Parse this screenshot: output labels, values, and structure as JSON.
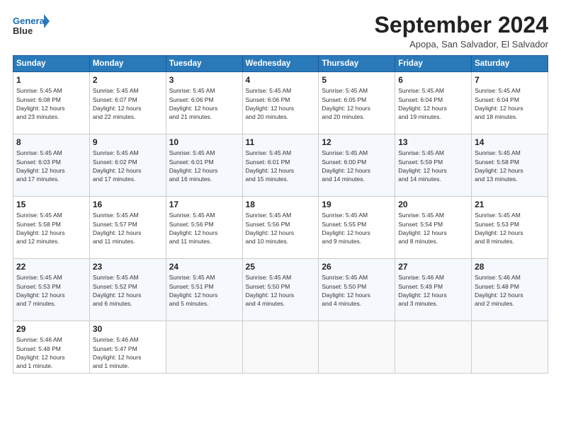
{
  "logo": {
    "line1": "General",
    "line2": "Blue"
  },
  "title": "September 2024",
  "location": "Apopa, San Salvador, El Salvador",
  "headers": [
    "Sunday",
    "Monday",
    "Tuesday",
    "Wednesday",
    "Thursday",
    "Friday",
    "Saturday"
  ],
  "weeks": [
    [
      {
        "day": "1",
        "info": "Sunrise: 5:45 AM\nSunset: 6:08 PM\nDaylight: 12 hours\nand 23 minutes."
      },
      {
        "day": "2",
        "info": "Sunrise: 5:45 AM\nSunset: 6:07 PM\nDaylight: 12 hours\nand 22 minutes."
      },
      {
        "day": "3",
        "info": "Sunrise: 5:45 AM\nSunset: 6:06 PM\nDaylight: 12 hours\nand 21 minutes."
      },
      {
        "day": "4",
        "info": "Sunrise: 5:45 AM\nSunset: 6:06 PM\nDaylight: 12 hours\nand 20 minutes."
      },
      {
        "day": "5",
        "info": "Sunrise: 5:45 AM\nSunset: 6:05 PM\nDaylight: 12 hours\nand 20 minutes."
      },
      {
        "day": "6",
        "info": "Sunrise: 5:45 AM\nSunset: 6:04 PM\nDaylight: 12 hours\nand 19 minutes."
      },
      {
        "day": "7",
        "info": "Sunrise: 5:45 AM\nSunset: 6:04 PM\nDaylight: 12 hours\nand 18 minutes."
      }
    ],
    [
      {
        "day": "8",
        "info": "Sunrise: 5:45 AM\nSunset: 6:03 PM\nDaylight: 12 hours\nand 17 minutes."
      },
      {
        "day": "9",
        "info": "Sunrise: 5:45 AM\nSunset: 6:02 PM\nDaylight: 12 hours\nand 17 minutes."
      },
      {
        "day": "10",
        "info": "Sunrise: 5:45 AM\nSunset: 6:01 PM\nDaylight: 12 hours\nand 16 minutes."
      },
      {
        "day": "11",
        "info": "Sunrise: 5:45 AM\nSunset: 6:01 PM\nDaylight: 12 hours\nand 15 minutes."
      },
      {
        "day": "12",
        "info": "Sunrise: 5:45 AM\nSunset: 6:00 PM\nDaylight: 12 hours\nand 14 minutes."
      },
      {
        "day": "13",
        "info": "Sunrise: 5:45 AM\nSunset: 5:59 PM\nDaylight: 12 hours\nand 14 minutes."
      },
      {
        "day": "14",
        "info": "Sunrise: 5:45 AM\nSunset: 5:58 PM\nDaylight: 12 hours\nand 13 minutes."
      }
    ],
    [
      {
        "day": "15",
        "info": "Sunrise: 5:45 AM\nSunset: 5:58 PM\nDaylight: 12 hours\nand 12 minutes."
      },
      {
        "day": "16",
        "info": "Sunrise: 5:45 AM\nSunset: 5:57 PM\nDaylight: 12 hours\nand 11 minutes."
      },
      {
        "day": "17",
        "info": "Sunrise: 5:45 AM\nSunset: 5:56 PM\nDaylight: 12 hours\nand 11 minutes."
      },
      {
        "day": "18",
        "info": "Sunrise: 5:45 AM\nSunset: 5:56 PM\nDaylight: 12 hours\nand 10 minutes."
      },
      {
        "day": "19",
        "info": "Sunrise: 5:45 AM\nSunset: 5:55 PM\nDaylight: 12 hours\nand 9 minutes."
      },
      {
        "day": "20",
        "info": "Sunrise: 5:45 AM\nSunset: 5:54 PM\nDaylight: 12 hours\nand 8 minutes."
      },
      {
        "day": "21",
        "info": "Sunrise: 5:45 AM\nSunset: 5:53 PM\nDaylight: 12 hours\nand 8 minutes."
      }
    ],
    [
      {
        "day": "22",
        "info": "Sunrise: 5:45 AM\nSunset: 5:53 PM\nDaylight: 12 hours\nand 7 minutes."
      },
      {
        "day": "23",
        "info": "Sunrise: 5:45 AM\nSunset: 5:52 PM\nDaylight: 12 hours\nand 6 minutes."
      },
      {
        "day": "24",
        "info": "Sunrise: 5:45 AM\nSunset: 5:51 PM\nDaylight: 12 hours\nand 5 minutes."
      },
      {
        "day": "25",
        "info": "Sunrise: 5:45 AM\nSunset: 5:50 PM\nDaylight: 12 hours\nand 4 minutes."
      },
      {
        "day": "26",
        "info": "Sunrise: 5:45 AM\nSunset: 5:50 PM\nDaylight: 12 hours\nand 4 minutes."
      },
      {
        "day": "27",
        "info": "Sunrise: 5:46 AM\nSunset: 5:49 PM\nDaylight: 12 hours\nand 3 minutes."
      },
      {
        "day": "28",
        "info": "Sunrise: 5:46 AM\nSunset: 5:48 PM\nDaylight: 12 hours\nand 2 minutes."
      }
    ],
    [
      {
        "day": "29",
        "info": "Sunrise: 5:46 AM\nSunset: 5:48 PM\nDaylight: 12 hours\nand 1 minute."
      },
      {
        "day": "30",
        "info": "Sunrise: 5:46 AM\nSunset: 5:47 PM\nDaylight: 12 hours\nand 1 minute."
      },
      {
        "day": "",
        "info": ""
      },
      {
        "day": "",
        "info": ""
      },
      {
        "day": "",
        "info": ""
      },
      {
        "day": "",
        "info": ""
      },
      {
        "day": "",
        "info": ""
      }
    ]
  ]
}
